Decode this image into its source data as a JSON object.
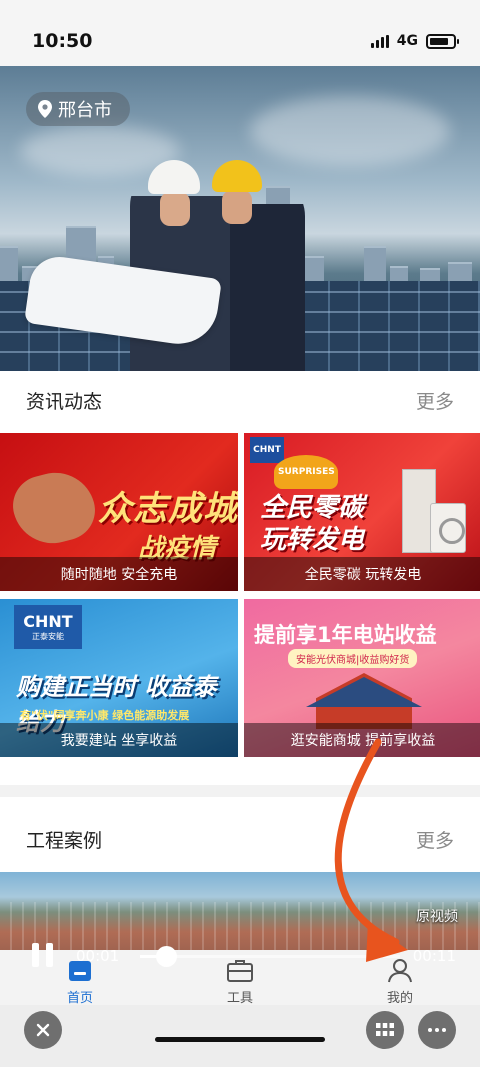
{
  "status": {
    "time": "10:50",
    "network": "4G"
  },
  "hero": {
    "location": "邢台市"
  },
  "news": {
    "title": "资讯动态",
    "more": "更多",
    "cards": [
      {
        "caption": "随时随地 安全充电",
        "art_line1": "众志成城",
        "art_line2": "战疫情"
      },
      {
        "caption": "全民零碳 玩转发电",
        "brand": "CHNT",
        "art_line1": "全民零碳",
        "art_line2": "玩转发电",
        "burst": "SURPRISES"
      },
      {
        "caption": "我要建站 坐享收益",
        "brand": "CHNT",
        "brand_sub": "正泰安能",
        "art_line1": "购建正当时 收益泰给力",
        "art_line2": "有\"伏\"同享奔小康  绿色能源助发展"
      },
      {
        "caption": "逛安能商城 提前享收益",
        "art_line1": "提前享1年电站收益",
        "art_line2": "安能光伏商城|收益购好货"
      }
    ]
  },
  "projects": {
    "title": "工程案例",
    "more": "更多"
  },
  "video": {
    "label": "原视频",
    "current": "00:01",
    "total": "00:11",
    "progress": 0.1
  },
  "tabs": [
    {
      "label": "首页",
      "icon": "home-icon",
      "active": true
    },
    {
      "label": "工具",
      "icon": "toolbox-icon",
      "active": false
    },
    {
      "label": "我的",
      "icon": "profile-icon",
      "active": false
    }
  ],
  "colors": {
    "accent": "#1d6fd1",
    "annotation": "#e8541e"
  }
}
